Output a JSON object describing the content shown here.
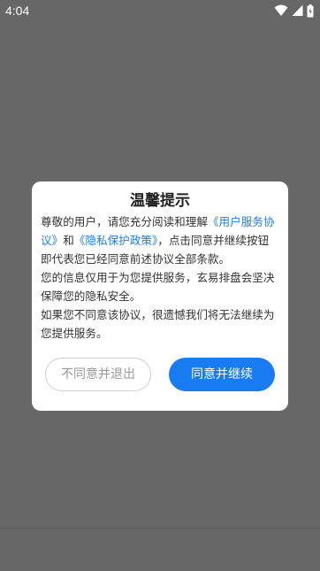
{
  "status_bar": {
    "time": "4:04",
    "icons": [
      "wifi-icon",
      "signal-icon",
      "battery-icon"
    ]
  },
  "dialog": {
    "title": "温馨提示",
    "paragraph1": {
      "text_before": "尊敬的用户，请您充分阅读和理解",
      "link_user_agreement": "《用户服务协议》",
      "text_and": "和",
      "link_privacy_policy": "《隐私保护政策》",
      "text_after": "，点击同意并继续按钮即代表您已经同意前述协议全部条款。"
    },
    "paragraph2": "您的信息仅用于为您提供服务，玄易排盘会坚决保障您的隐私安全。",
    "paragraph3": "如果您不同意该协议，很遗憾我们将无法继续为您提供服务。",
    "decline_label": "不同意并退出",
    "accept_label": "同意并继续"
  },
  "colors": {
    "overlay": "#676767",
    "accent": "#1a7cf2",
    "dialog_bg": "#ffffff"
  }
}
